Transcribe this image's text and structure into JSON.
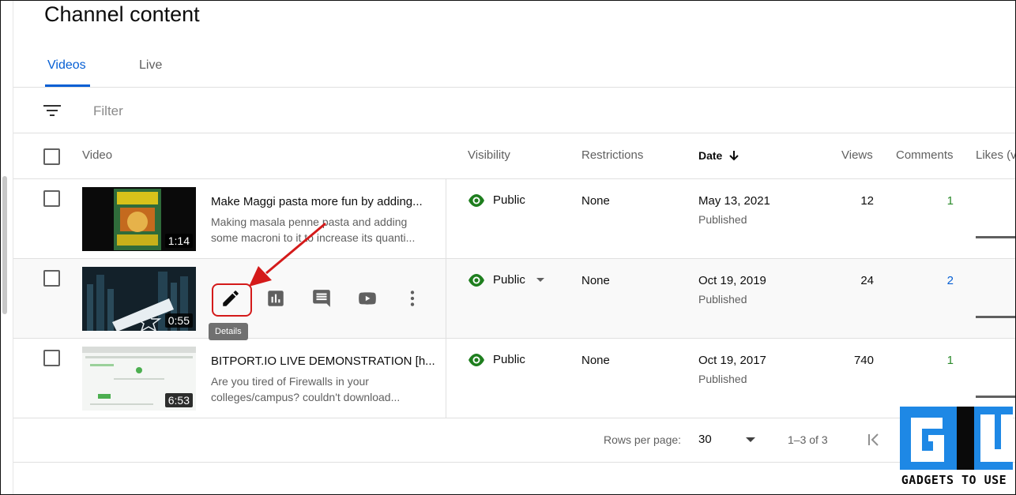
{
  "page": {
    "title": "Channel content"
  },
  "tabs": [
    {
      "label": "Videos",
      "active": true
    },
    {
      "label": "Live",
      "active": false
    }
  ],
  "filter": {
    "placeholder": "Filter"
  },
  "columns": {
    "video": "Video",
    "visibility": "Visibility",
    "restrictions": "Restrictions",
    "date": "Date",
    "views": "Views",
    "comments": "Comments",
    "likes": "Likes (v"
  },
  "rows": [
    {
      "title": "Make Maggi pasta more fun by adding...",
      "desc1": "Making masala penne pasta and adding",
      "desc2": "some macroni to it to increase its quanti...",
      "duration": "1:14",
      "visibility": "Public",
      "restrictions": "None",
      "date": "May 13, 2021",
      "status": "Published",
      "views": "12",
      "comments": "1"
    },
    {
      "title": "",
      "duration": "0:55",
      "visibility": "Public",
      "restrictions": "None",
      "date": "Oct 19, 2019",
      "status": "Published",
      "views": "24",
      "comments": "2",
      "tooltip": "Details"
    },
    {
      "title": "BITPORT.IO LIVE DEMONSTRATION [h...",
      "desc1": "Are you tired of Firewalls in your",
      "desc2": "colleges/campus? couldn't download...",
      "duration": "6:53",
      "visibility": "Public",
      "restrictions": "None",
      "date": "Oct 19, 2017",
      "status": "Published",
      "views": "740",
      "comments": "1"
    }
  ],
  "pagination": {
    "rows_per_page_label": "Rows per page:",
    "rows_per_page": "30",
    "range": "1–3 of 3"
  },
  "watermark": {
    "text": "GADGETS TO USE"
  },
  "colors": {
    "accent": "#065fd4",
    "public_green": "#1e7e1e",
    "highlight_red": "#d41a1a"
  }
}
